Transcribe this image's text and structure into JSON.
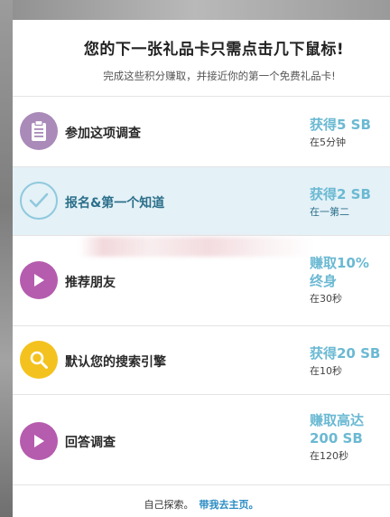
{
  "header": {
    "title": "您的下一张礼品卡只需点击几下鼠标!",
    "subtitle": "完成这些积分赚取，并接近你的第一个免费礼品卡!"
  },
  "offers": [
    {
      "label": "参加这项调查",
      "reward": "获得5 SB",
      "time": "在5分钟",
      "icon": "clipboard-icon",
      "highlight": false
    },
    {
      "label": "报名&第一个知道",
      "reward": "获得2 SB",
      "time": "在一第二",
      "icon": "checkmark-icon",
      "highlight": true
    },
    {
      "label": "推荐朋友",
      "reward_line1": "赚取10%",
      "reward_line2": "终身",
      "time": "在30秒",
      "icon": "play-icon",
      "highlight": false
    },
    {
      "label": "默认您的搜索引擎",
      "reward": "获得20 SB",
      "time": "在10秒",
      "icon": "search-icon",
      "highlight": false
    },
    {
      "label": "回答调查",
      "reward_line1": "赚取高达",
      "reward_line2": "200 SB",
      "time": "在120秒",
      "icon": "play-icon",
      "highlight": false
    }
  ],
  "footer": {
    "text": "自己探索。",
    "link": "带我去主页。"
  },
  "colors": {
    "accent": "#6bb9d3",
    "link": "#2b8cc4",
    "highlight_bg": "#e4f1f7",
    "purple": "#a98ab8",
    "magenta": "#b55cae",
    "yellow": "#f4c21e"
  }
}
